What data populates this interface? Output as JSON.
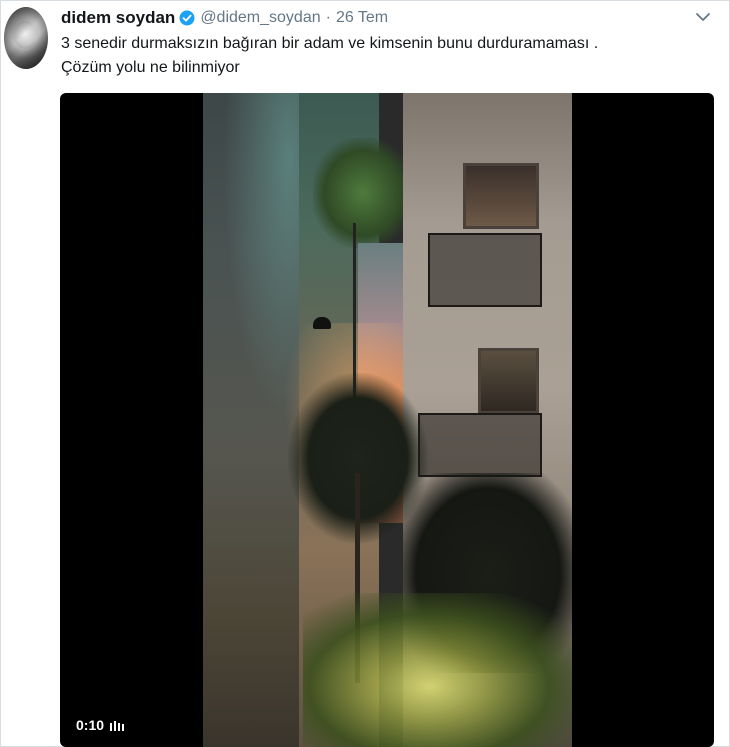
{
  "tweet": {
    "author_name": "didem soydan",
    "handle": "@didem_soydan",
    "separator": "·",
    "date": "26 Tem",
    "text_line_1": "3 senedir durmaksızın bağıran bir adam ve kimsenin bunu durduramaması .",
    "text_line_2": "Çözüm yolu ne bilinmiyor",
    "verified": true
  },
  "media": {
    "duration": "0:10",
    "type": "video"
  },
  "icons": {
    "verified": "verified-badge-icon",
    "menu": "chevron-down-icon",
    "volume": "volume-bars-icon"
  },
  "colors": {
    "name": "#14171a",
    "meta": "#657786",
    "verified": "#1da1f2",
    "video_bg": "#000000"
  }
}
